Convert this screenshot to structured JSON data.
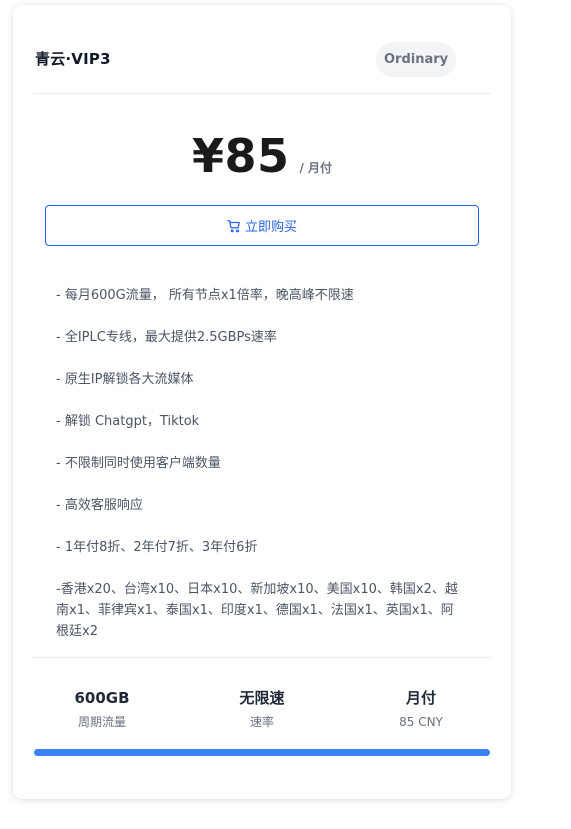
{
  "plan": {
    "title": "青云·VIP3",
    "badge": "Ordinary"
  },
  "price": {
    "amount": "¥85",
    "unit": "/ 月付"
  },
  "buy_button": {
    "label": "立即购买",
    "icon": "cart-icon"
  },
  "features": [
    "- 每月600G流量， 所有节点x1倍率，晚高峰不限速",
    "- 全IPLC专线，最大提供2.5GBPs速率",
    "- 原生IP解锁各大流媒体",
    "- 解锁 Chatgpt，Tiktok",
    "- 不限制同时使用客户端数量",
    "- 高效客服响应",
    "- 1年付8折、2年付7折、3年付6折",
    "-香港x20、台湾x10、日本x10、新加坡x10、美国x10、韩国x2、越南x1、菲律宾x1、泰国x1、印度x1、德国x1、法国x1、英国x1、阿根廷x2"
  ],
  "stats": [
    {
      "value": "600GB",
      "label": "周期流量"
    },
    {
      "value": "无限速",
      "label": "速率"
    },
    {
      "value": "月付",
      "label": "85 CNY"
    }
  ],
  "progress": {
    "fraction": 1.0,
    "color": "#3b82f6"
  },
  "colors": {
    "accent": "#2563eb",
    "text_primary": "#111827",
    "text_secondary": "#6b7280"
  }
}
